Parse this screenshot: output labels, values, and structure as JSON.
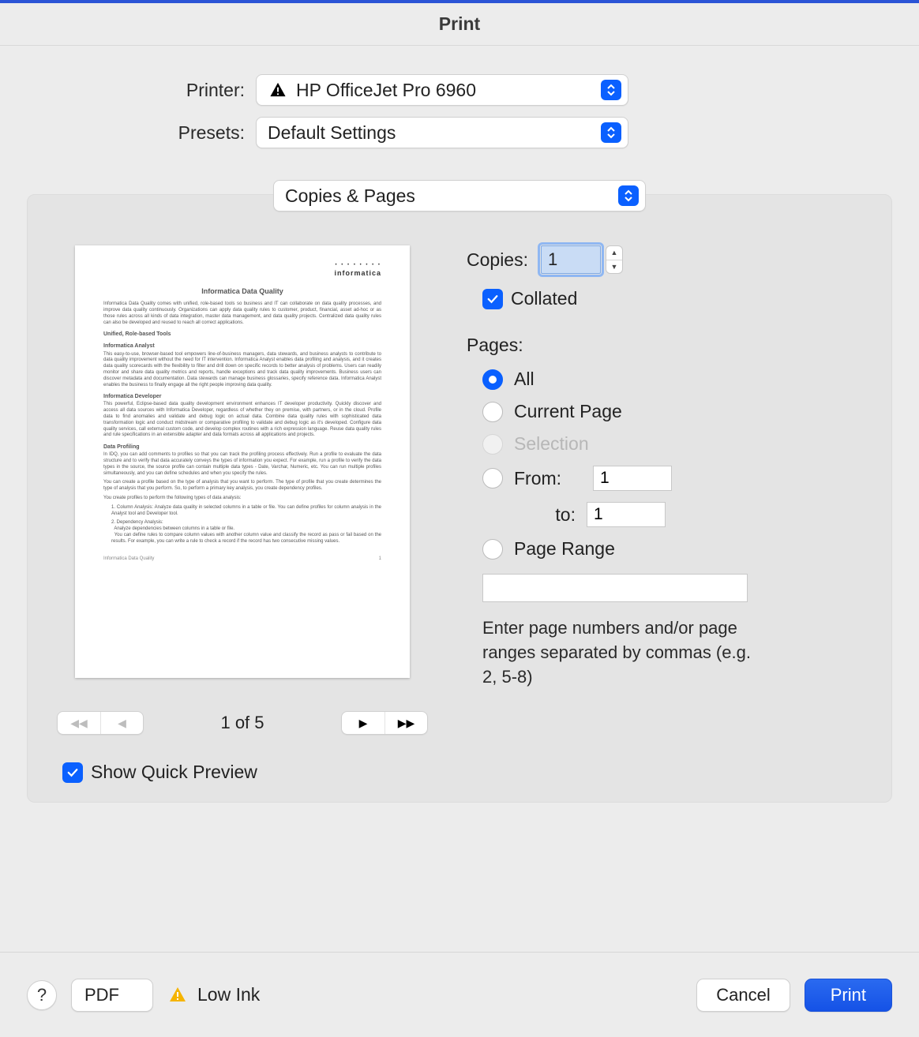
{
  "title": "Print",
  "printer": {
    "label": "Printer:",
    "value": "HP OfficeJet Pro 6960",
    "warning": true
  },
  "presets": {
    "label": "Presets:",
    "value": "Default Settings"
  },
  "section": {
    "value": "Copies & Pages"
  },
  "copies": {
    "label": "Copies:",
    "value": "1"
  },
  "collated": {
    "label": "Collated",
    "checked": true
  },
  "pages": {
    "heading": "Pages:",
    "options": {
      "all": "All",
      "current": "Current Page",
      "selection": "Selection",
      "from_label": "From:",
      "from_value": "1",
      "to_label": "to:",
      "to_value": "1",
      "range": "Page Range",
      "range_value": ""
    },
    "selected": "all",
    "hint": "Enter page numbers and/or page ranges separated by commas (e.g. 2, 5-8)"
  },
  "preview": {
    "doc_title": "Informatica Data Quality",
    "brand": "informatica",
    "page_indicator": "1 of 5",
    "footer_left": "Informatica Data Quality",
    "footer_right": "1"
  },
  "show_quick_preview": {
    "label": "Show Quick Preview",
    "checked": true
  },
  "footer": {
    "pdf": "PDF",
    "low_ink": "Low Ink",
    "cancel": "Cancel",
    "print": "Print"
  }
}
